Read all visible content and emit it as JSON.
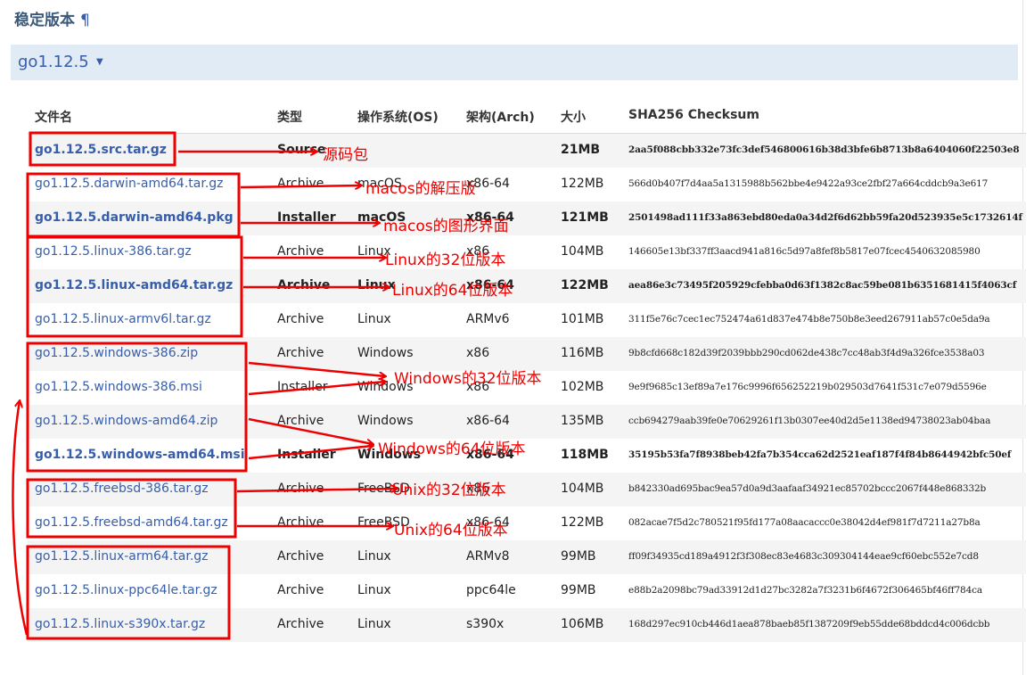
{
  "heading": {
    "title": "稳定版本",
    "pilcrow": "¶"
  },
  "version": {
    "label": "go1.12.5",
    "caret": "▼"
  },
  "table": {
    "headers": [
      "文件名",
      "类型",
      "操作系统(OS)",
      "架构(Arch)",
      "大小",
      "SHA256 Checksum"
    ],
    "rows": [
      {
        "file": "go1.12.5.src.tar.gz",
        "kind": "Source",
        "os": "",
        "arch": "",
        "size": "21MB",
        "sha": "2aa5f088cbb332e73fc3def546800616b38d3bfe6b8713b8a6404060f22503e8"
      },
      {
        "file": "go1.12.5.darwin-amd64.tar.gz",
        "kind": "Archive",
        "os": "macOS",
        "arch": "x86-64",
        "size": "122MB",
        "sha": "566d0b407f7d4aa5a1315988b562bbe4e9422a93ce2fbf27a664cddcb9a3e617"
      },
      {
        "file": "go1.12.5.darwin-amd64.pkg",
        "kind": "Installer",
        "os": "macOS",
        "arch": "x86-64",
        "size": "121MB",
        "sha": "2501498ad111f33a863ebd80eda0a34d2f6d62bb59fa20d523935e5c1732614f"
      },
      {
        "file": "go1.12.5.linux-386.tar.gz",
        "kind": "Archive",
        "os": "Linux",
        "arch": "x86",
        "size": "104MB",
        "sha": "146605e13bf337ff3aacd941a816c5d97a8fef8b5817e07fcec4540632085980"
      },
      {
        "file": "go1.12.5.linux-amd64.tar.gz",
        "kind": "Archive",
        "os": "Linux",
        "arch": "x86-64",
        "size": "122MB",
        "sha": "aea86e3c73495f205929cfebba0d63f1382c8ac59be081b6351681415f4063cf"
      },
      {
        "file": "go1.12.5.linux-armv6l.tar.gz",
        "kind": "Archive",
        "os": "Linux",
        "arch": "ARMv6",
        "size": "101MB",
        "sha": "311f5e76c7cec1ec752474a61d837e474b8e750b8e3eed267911ab57c0e5da9a"
      },
      {
        "file": "go1.12.5.windows-386.zip",
        "kind": "Archive",
        "os": "Windows",
        "arch": "x86",
        "size": "116MB",
        "sha": "9b8cfd668c182d39f2039bbb290cd062de438c7cc48ab3f4d9a326fce3538a03"
      },
      {
        "file": "go1.12.5.windows-386.msi",
        "kind": "Installer",
        "os": "Windows",
        "arch": "x86",
        "size": "102MB",
        "sha": "9e9f9685c13ef89a7e176c9996f656252219b029503d7641f531c7e079d5596e"
      },
      {
        "file": "go1.12.5.windows-amd64.zip",
        "kind": "Archive",
        "os": "Windows",
        "arch": "x86-64",
        "size": "135MB",
        "sha": "ccb694279aab39fe0e70629261f13b0307ee40d2d5e1138ed94738023ab04baa"
      },
      {
        "file": "go1.12.5.windows-amd64.msi",
        "kind": "Installer",
        "os": "Windows",
        "arch": "x86-64",
        "size": "118MB",
        "sha": "35195b53fa7f8938beb42fa7b354cca62d2521eaf187f4f84b8644942bfc50ef"
      },
      {
        "file": "go1.12.5.freebsd-386.tar.gz",
        "kind": "Archive",
        "os": "FreeBSD",
        "arch": "x86",
        "size": "104MB",
        "sha": "b842330ad695bac9ea57d0a9d3aafaaf34921ec85702bccc2067f448e868332b"
      },
      {
        "file": "go1.12.5.freebsd-amd64.tar.gz",
        "kind": "Archive",
        "os": "FreeBSD",
        "arch": "x86-64",
        "size": "122MB",
        "sha": "082acae7f5d2c780521f95fd177a08aacaccc0e38042d4ef981f7d7211a27b8a"
      },
      {
        "file": "go1.12.5.linux-arm64.tar.gz",
        "kind": "Archive",
        "os": "Linux",
        "arch": "ARMv8",
        "size": "99MB",
        "sha": "ff09f34935cd189a4912f3f308ec83e4683c309304144eae9cf60ebc552e7cd8"
      },
      {
        "file": "go1.12.5.linux-ppc64le.tar.gz",
        "kind": "Archive",
        "os": "Linux",
        "arch": "ppc64le",
        "size": "99MB",
        "sha": "e88b2a2098bc79ad33912d1d27bc3282a7f3231b6f4672f306465bf46ff784ca"
      },
      {
        "file": "go1.12.5.linux-s390x.tar.gz",
        "kind": "Archive",
        "os": "Linux",
        "arch": "s390x",
        "size": "106MB",
        "sha": "168d297ec910cb446d1aea878baeb85f1387209f9eb55dde68bddcd4c006dcbb"
      }
    ]
  },
  "annotations": [
    "源码包",
    "macos的解压版",
    "macos的图形界面",
    "Linux的32位版本",
    "Linux的64位版本",
    "Windows的32位版本",
    "Windows的64位版本",
    "Unix的32位版本",
    "Unix的64位版本"
  ],
  "colors": {
    "annotation": "#ee0000",
    "link": "#375eab",
    "version_bar": "#e0ebf5",
    "row_stripe": "#f4f4f4"
  }
}
